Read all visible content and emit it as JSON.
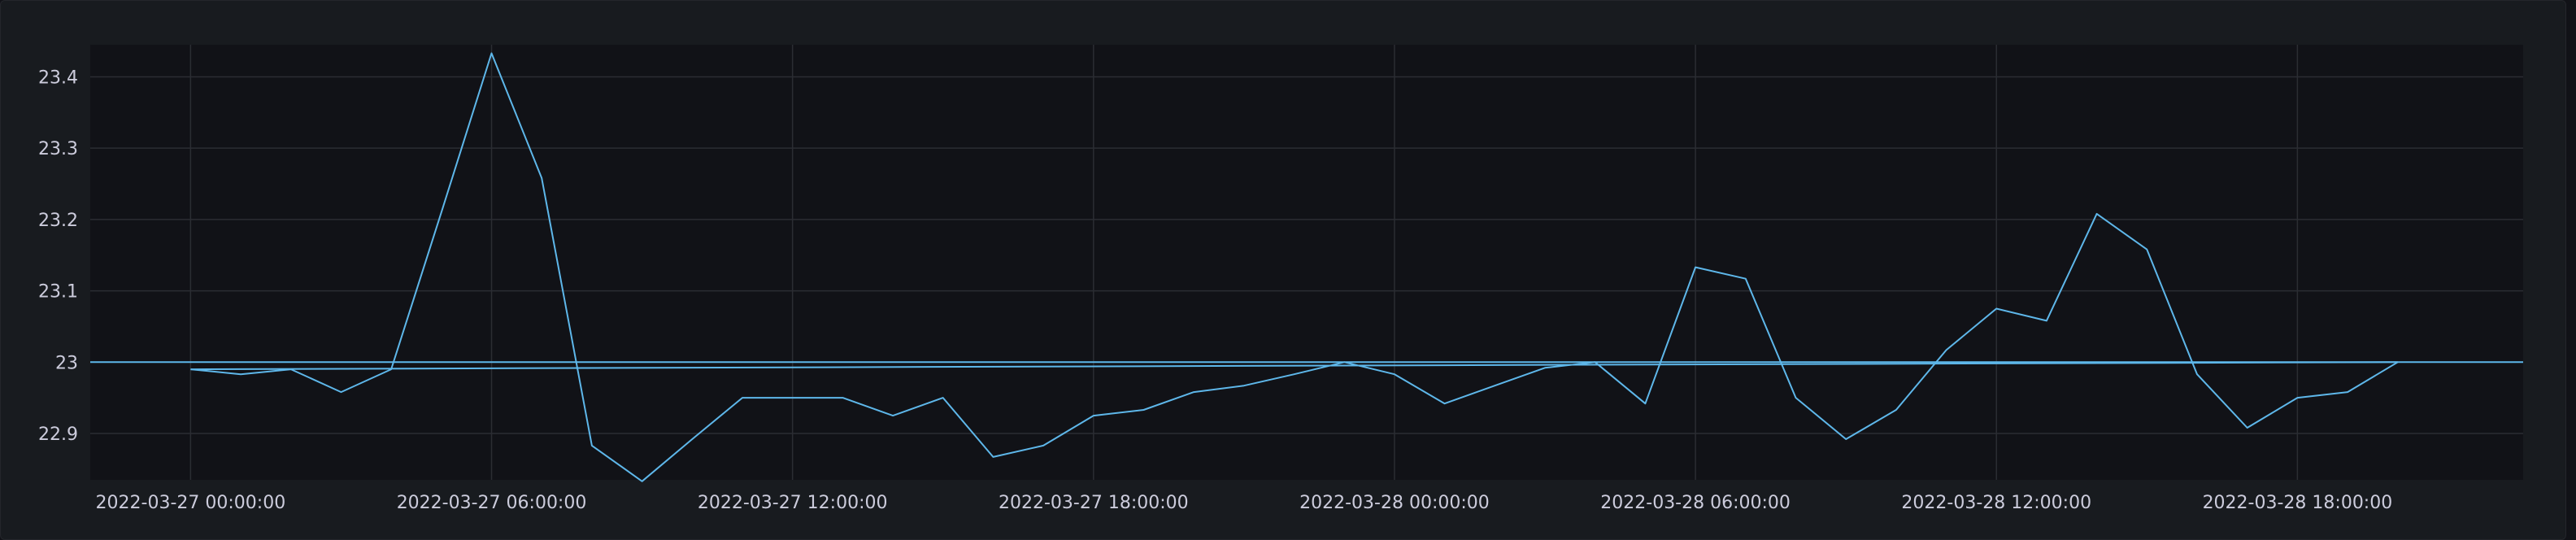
{
  "chart_data": {
    "type": "line",
    "grid": true,
    "legend": "none",
    "colors": {
      "panel_background": "#181b1f",
      "plot_background": "#111217",
      "series": "#5eb7ea",
      "gridline": "#2b2d33",
      "text": "#ccccdc"
    },
    "xlim": [
      "2022-03-26 22:00:00",
      "2022-03-28 22:30:00"
    ],
    "ylim": [
      22.835,
      23.445
    ],
    "x_ticks": [
      "2022-03-27 00:00:00",
      "2022-03-27 06:00:00",
      "2022-03-27 12:00:00",
      "2022-03-27 18:00:00",
      "2022-03-28 00:00:00",
      "2022-03-28 06:00:00",
      "2022-03-28 12:00:00",
      "2022-03-28 18:00:00"
    ],
    "y_ticks": [
      {
        "value": 22.9,
        "label": "22.9"
      },
      {
        "value": 23.0,
        "label": "23"
      },
      {
        "value": 23.1,
        "label": "23.1"
      },
      {
        "value": 23.2,
        "label": "23.2"
      },
      {
        "value": 23.3,
        "label": "23.3"
      },
      {
        "value": 23.4,
        "label": "23.4"
      }
    ],
    "series": [
      {
        "x": [
          "2022-03-27 00:00:00",
          "2022-03-27 01:00:00",
          "2022-03-27 02:00:00",
          "2022-03-27 03:00:00",
          "2022-03-27 04:00:00",
          "2022-03-27 05:00:00",
          "2022-03-27 06:00:00",
          "2022-03-27 07:00:00",
          "2022-03-27 08:00:00",
          "2022-03-27 09:00:00",
          "2022-03-27 10:00:00",
          "2022-03-27 11:00:00",
          "2022-03-27 12:00:00",
          "2022-03-27 13:00:00",
          "2022-03-27 14:00:00",
          "2022-03-27 15:00:00",
          "2022-03-27 16:00:00",
          "2022-03-27 17:00:00",
          "2022-03-27 18:00:00",
          "2022-03-27 19:00:00",
          "2022-03-27 20:00:00",
          "2022-03-27 21:00:00",
          "2022-03-27 22:00:00",
          "2022-03-27 23:00:00",
          "2022-03-28 00:00:00",
          "2022-03-28 01:00:00",
          "2022-03-28 02:00:00",
          "2022-03-28 03:00:00",
          "2022-03-28 04:00:00",
          "2022-03-28 05:00:00",
          "2022-03-28 06:00:00",
          "2022-03-28 07:00:00",
          "2022-03-28 08:00:00",
          "2022-03-28 09:00:00",
          "2022-03-28 10:00:00",
          "2022-03-28 11:00:00",
          "2022-03-28 12:00:00",
          "2022-03-28 13:00:00",
          "2022-03-28 14:00:00",
          "2022-03-28 15:00:00",
          "2022-03-28 16:00:00",
          "2022-03-28 17:00:00",
          "2022-03-28 18:00:00",
          "2022-03-28 19:00:00",
          "2022-03-28 20:00:00"
        ],
        "values": [
          22.99,
          22.983,
          22.99,
          22.958,
          22.99,
          23.21,
          23.433,
          23.258,
          22.883,
          22.833,
          22.892,
          22.95,
          22.95,
          22.95,
          22.925,
          22.95,
          22.867,
          22.883,
          22.925,
          22.933,
          22.958,
          22.967,
          22.983,
          23.0,
          22.983,
          22.942,
          22.967,
          22.992,
          23.0,
          22.942,
          23.133,
          23.117,
          22.95,
          22.892,
          22.933,
          23.017,
          23.075,
          23.058,
          23.208,
          23.158,
          22.983,
          22.908,
          22.95,
          22.958,
          23.0
        ]
      },
      {
        "x": [
          "2022-03-26 22:00:00",
          "2022-03-28 22:30:00"
        ],
        "values": [
          23.0,
          23.0
        ]
      },
      {
        "x": [
          "2022-03-27 00:00:00",
          "2022-03-28 20:00:00"
        ],
        "values": [
          22.99,
          23.0
        ]
      }
    ]
  }
}
